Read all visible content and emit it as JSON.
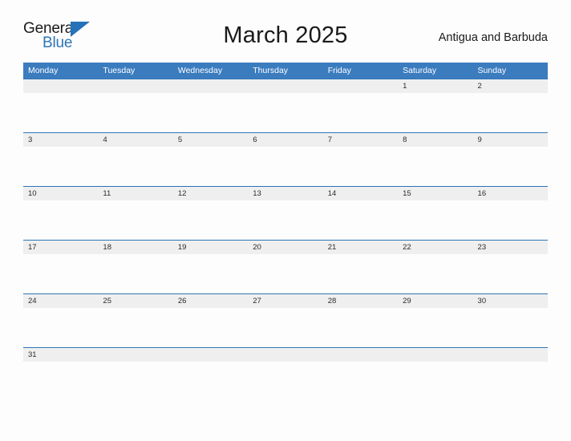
{
  "brand": {
    "word_one": "General",
    "word_two": "Blue",
    "flag_icon": "flag-triangle-icon"
  },
  "header": {
    "title": "March 2025",
    "locale": "Antigua and Barbuda"
  },
  "colors": {
    "header_blue": "#3b7cbf",
    "rule_blue": "#2e75b6",
    "brand_blue": "#2572b8",
    "date_band_gray": "#efefef",
    "page_background": "#fdfdfd",
    "text_dark": "#1a1a1a"
  },
  "calendar": {
    "weekdays": [
      "Monday",
      "Tuesday",
      "Wednesday",
      "Thursday",
      "Friday",
      "Saturday",
      "Sunday"
    ],
    "weeks": [
      [
        "",
        "",
        "",
        "",
        "",
        "1",
        "2"
      ],
      [
        "3",
        "4",
        "5",
        "6",
        "7",
        "8",
        "9"
      ],
      [
        "10",
        "11",
        "12",
        "13",
        "14",
        "15",
        "16"
      ],
      [
        "17",
        "18",
        "19",
        "20",
        "21",
        "22",
        "23"
      ],
      [
        "24",
        "25",
        "26",
        "27",
        "28",
        "29",
        "30"
      ],
      [
        "31",
        "",
        "",
        "",
        "",
        "",
        ""
      ]
    ]
  }
}
